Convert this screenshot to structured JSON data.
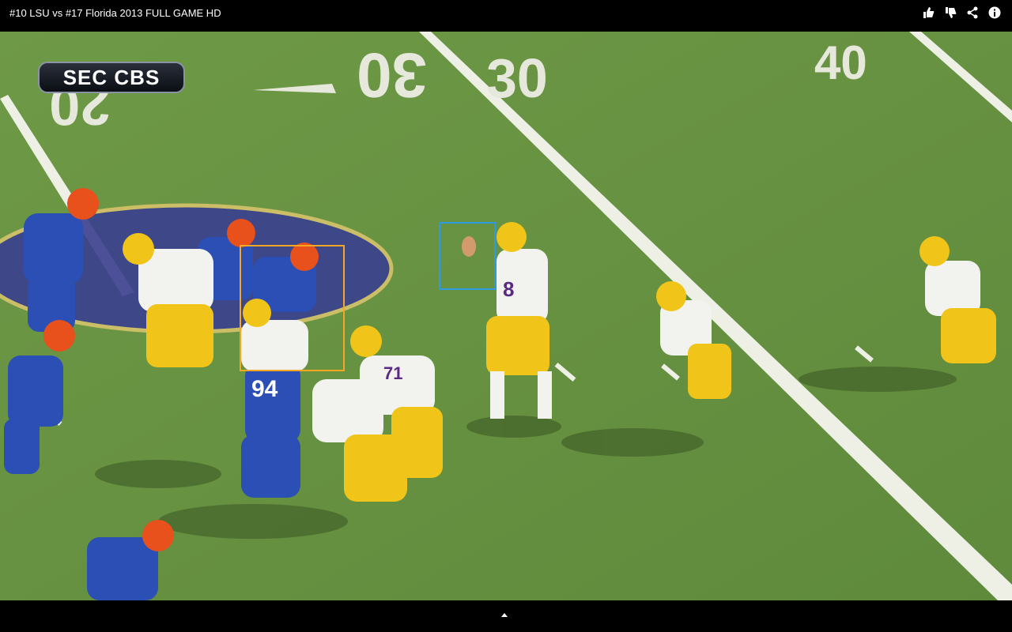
{
  "header": {
    "title": "#10 LSU vs #17 Florida 2013 FULL GAME HD",
    "icons": [
      "thumbs-up-icon",
      "thumbs-down-icon",
      "share-icon",
      "info-icon"
    ]
  },
  "video": {
    "network_logo": "SEC CBS",
    "yard_numbers": [
      "20",
      "30",
      "30",
      "40"
    ],
    "jersey_numbers": [
      "94",
      "8",
      "71"
    ],
    "annotation_colors": {
      "orange_box": "#f5a623",
      "blue_box": "#2e9be6"
    }
  },
  "colors": {
    "field": "#6f9a45",
    "lsu_gold": "#f0c419",
    "florida_blue": "#2c4fb5",
    "florida_orange": "#e8501c"
  }
}
